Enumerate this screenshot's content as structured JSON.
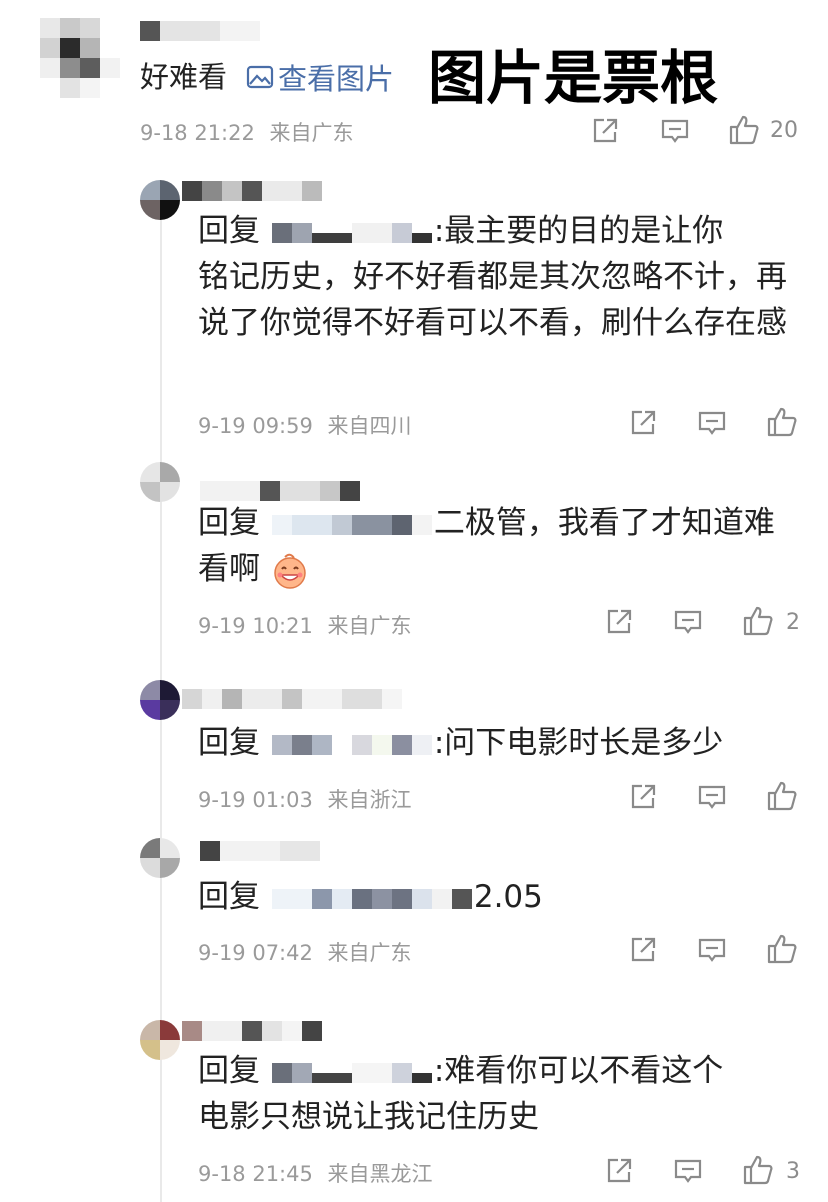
{
  "overlay_caption": "图片是票根",
  "main_comment": {
    "text": "好难看",
    "image_link_label": "查看图片",
    "timestamp": "9-18 21:22",
    "location": "来自广东",
    "likes": "20"
  },
  "replies": [
    {
      "reply_prefix": "回复",
      "text_line1": ":最主要的目的是让你",
      "text_rest": "铭记历史，好不好看都是其次忽略不计，再说了你觉得不好看可以不看，刷什么存在感",
      "timestamp": "9-19 09:59",
      "location": "来自四川",
      "likes": ""
    },
    {
      "reply_prefix": "回复",
      "text_line1": "二极管，我看了才知道难",
      "text_rest": "看啊",
      "timestamp": "9-19 10:21",
      "location": "来自广东",
      "likes": "2"
    },
    {
      "reply_prefix": "回复",
      "text_line1": ":问下电影时长是多少",
      "text_rest": "",
      "timestamp": "9-19 01:03",
      "location": "来自浙江",
      "likes": ""
    },
    {
      "reply_prefix": "回复",
      "text_line1": "2.05",
      "text_rest": "",
      "timestamp": "9-19 07:42",
      "location": "来自广东",
      "likes": ""
    },
    {
      "reply_prefix": "回复",
      "text_line1": ":难看你可以不看这个",
      "text_rest": "电影只想说让我记住历史",
      "timestamp": "9-18 21:45",
      "location": "来自黑龙江",
      "likes": "3"
    }
  ],
  "colors": {
    "link_blue": "#4a6ea8",
    "meta_gray": "#9a9a9a",
    "text_dark": "#222222"
  },
  "icons": [
    "repost-icon",
    "comment-icon",
    "like-icon",
    "image-icon",
    "emoji-grin-icon"
  ]
}
